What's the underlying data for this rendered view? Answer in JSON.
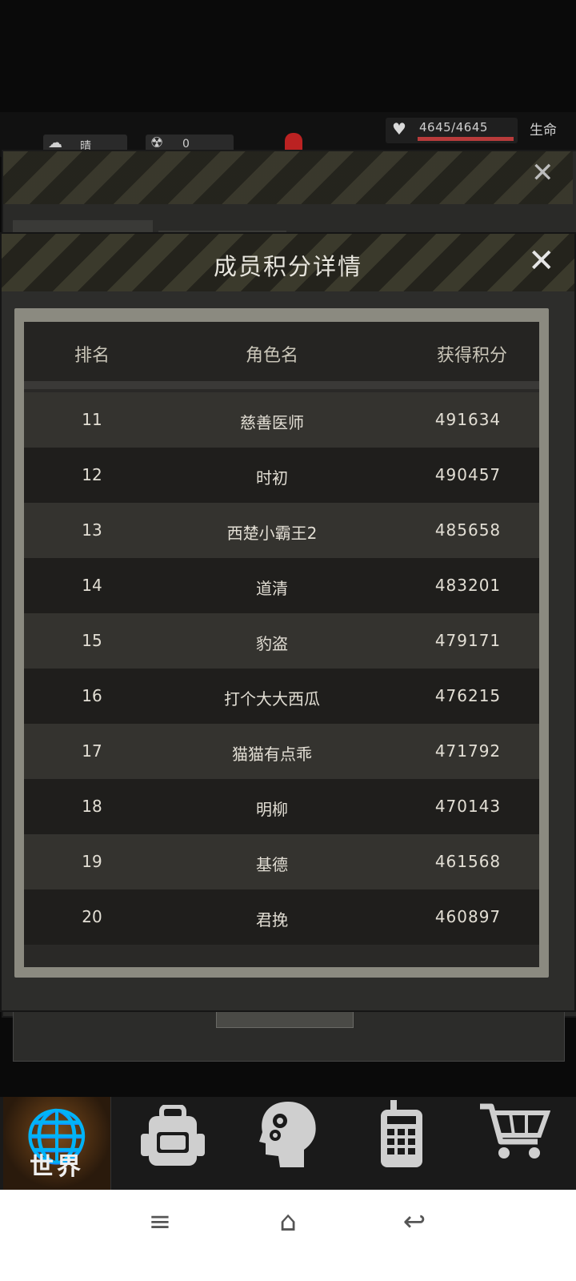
{
  "status": {
    "weather": "晴",
    "radiation": "0",
    "hp": "4645/4645",
    "hp_label": "生命",
    "hp_fraction": 1.0
  },
  "dialog": {
    "title": "成员积分详情",
    "close_symbol": "✕",
    "columns": {
      "rank": "排名",
      "name": "角色名",
      "score": "获得积分"
    },
    "rows": [
      {
        "rank": "11",
        "name": "慈善医师",
        "score": "491634"
      },
      {
        "rank": "12",
        "name": "时初",
        "score": "490457"
      },
      {
        "rank": "13",
        "name": "西楚小霸王2",
        "score": "485658"
      },
      {
        "rank": "14",
        "name": "道清",
        "score": "483201"
      },
      {
        "rank": "15",
        "name": "豹盗",
        "score": "479171"
      },
      {
        "rank": "16",
        "name": "打个大大西瓜",
        "score": "476215"
      },
      {
        "rank": "17",
        "name": "猫猫有点乖",
        "score": "471792"
      },
      {
        "rank": "18",
        "name": "明柳",
        "score": "470143"
      },
      {
        "rank": "19",
        "name": "基德",
        "score": "461568"
      },
      {
        "rank": "20",
        "name": "君挽",
        "score": "460897"
      }
    ]
  },
  "game_nav": {
    "world_label": "世界",
    "icons": [
      "globe-icon",
      "backpack-icon",
      "skills-head-icon",
      "radio-icon",
      "cart-icon"
    ]
  },
  "android_nav": {
    "menu": "≡",
    "home": "⌂",
    "back": "↩"
  }
}
